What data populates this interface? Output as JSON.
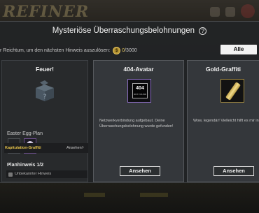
{
  "background": {
    "logo_text": "REFINER"
  },
  "dialog": {
    "title": "Mysteriöse Überraschungsbelohnungen",
    "hint_text": "r Reichtum, um den nächsten Hinweis auszulösen:",
    "coin_value": "0",
    "coin_max": "/3000",
    "all_button": "Alle"
  },
  "cards": {
    "left": {
      "title": "Feuer!",
      "egg_label": "Easter Egg-Plan",
      "slot_unknown": "?",
      "plan_label": "Planhinweis 1/2",
      "hint_box": "Unbekannter Hinweis",
      "graffiti_label": "Kapitulation-Graffiti",
      "view_label": "Ansehen",
      "chevron": "›"
    },
    "middle": {
      "title": "404-Avatar",
      "icon_text": "404",
      "icon_subtext": "NOT FOUND",
      "description": "Netzwerkverbindung aufgebaut. Deine Überraschungsbelohnung wurde gefunden!",
      "button": "Ansehen"
    },
    "right": {
      "title": "Gold-Graffiti",
      "description": "Wow, legendär! Vielleicht hilft es mir in Zu",
      "button": "Ansehen"
    }
  },
  "colors": {
    "accent_gold": "#e4c55a",
    "dialog_bg": "#222426",
    "card_bg": "#34373b"
  }
}
